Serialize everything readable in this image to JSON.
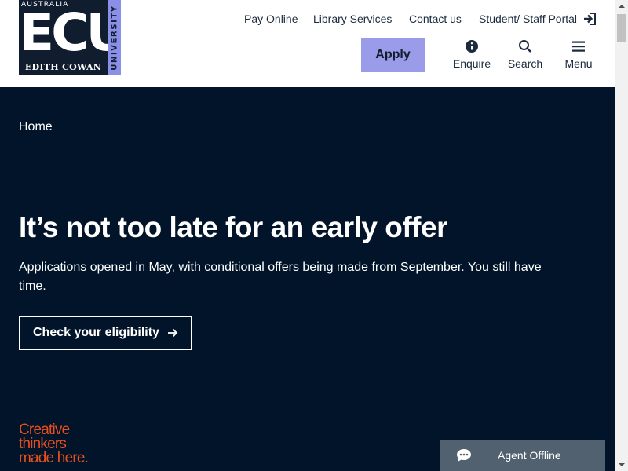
{
  "logo": {
    "top_text": "AUSTRALIA",
    "main_text": "ECU",
    "bottom_text": "EDITH COWAN",
    "side_text": "UNIVERSITY",
    "colors": {
      "navy": "#0f1d2e",
      "lavender": "#8c8fe8"
    }
  },
  "top_links": [
    "Pay Online",
    "Library Services",
    "Contact us",
    "Student/ Staff Portal"
  ],
  "nav": {
    "apply_label": "Apply",
    "enquire_label": "Enquire",
    "search_label": "Search",
    "menu_label": "Menu"
  },
  "hero": {
    "breadcrumb": "Home",
    "title": "It’s not too late for an early offer",
    "subtitle": "Applications opened in May, with conditional offers being made from September. You still have time.",
    "cta_label": "Check your eligibility",
    "tagline": [
      "Creative",
      "thinkers",
      "made here."
    ],
    "colors": {
      "background": "#02142a",
      "tagline": "#ea4f1d",
      "apply": "#9a9ce9"
    }
  },
  "chat": {
    "status": "Agent Offline",
    "icon": "chat-bubble-icon"
  }
}
